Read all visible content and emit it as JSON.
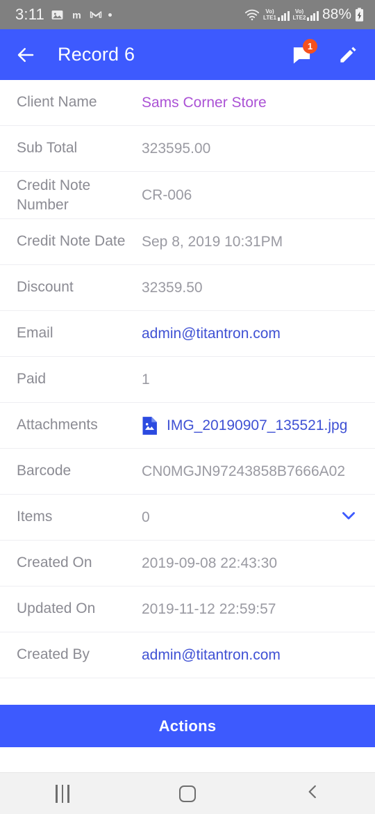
{
  "statusbar": {
    "time": "3:11",
    "icons": [
      "gallery-icon",
      "m-app-icon",
      "gmail-icon",
      "dot-indicator"
    ],
    "wifi": "wifi-icon",
    "sim1_label_top": "Vo)",
    "sim1_label_bottom": "LTE1",
    "sim2_label_top": "Vo)",
    "sim2_label_bottom": "LTE2",
    "battery": "88%",
    "battery_state": "charging"
  },
  "appbar": {
    "back_icon": "arrow-back-icon",
    "title": "Record 6",
    "messages_icon": "chat-bubble-icon",
    "messages_badge": "1",
    "edit_icon": "pencil-edit-icon",
    "background_color": "#3d5afe"
  },
  "fields": [
    {
      "label": "Client Name",
      "value": "Sams Corner Store",
      "style": "purple-link"
    },
    {
      "label": "Sub Total",
      "value": "323595.00",
      "style": "plain"
    },
    {
      "label": "Credit Note Number",
      "value": "CR-006",
      "style": "plain"
    },
    {
      "label": "Credit Note Date",
      "value": "Sep 8, 2019 10:31PM",
      "style": "plain"
    },
    {
      "label": "Discount",
      "value": "32359.50",
      "style": "plain"
    },
    {
      "label": "Email",
      "value": "admin@titantron.com",
      "style": "blue-link"
    },
    {
      "label": "Paid",
      "value": "1",
      "style": "plain"
    },
    {
      "label": "Attachments",
      "value": "IMG_20190907_135521.jpg",
      "style": "blue-link-file"
    },
    {
      "label": "Barcode",
      "value": "CN0MGJN97243858B7666A02",
      "style": "plain"
    },
    {
      "label": "Items",
      "value": "0",
      "style": "expandable"
    },
    {
      "label": "Created On",
      "value": "2019-09-08 22:43:30",
      "style": "plain"
    },
    {
      "label": "Updated On",
      "value": "2019-11-12 22:59:57",
      "style": "plain"
    },
    {
      "label": "Created By",
      "value": "admin@titantron.com",
      "style": "blue-link"
    }
  ],
  "footer": {
    "actions_label": "Actions"
  },
  "navbar": {
    "recents": "recents-icon",
    "home": "home-icon",
    "back": "back-chevron-icon"
  },
  "colors": {
    "accent_blue": "#3d5afe",
    "link_blue": "#3f51d4",
    "link_purple": "#ab52d5",
    "label_gray": "#8b8b93",
    "value_gray": "#9a9aa2",
    "badge_red": "#f4511e",
    "statusbar_gray": "#808080"
  }
}
